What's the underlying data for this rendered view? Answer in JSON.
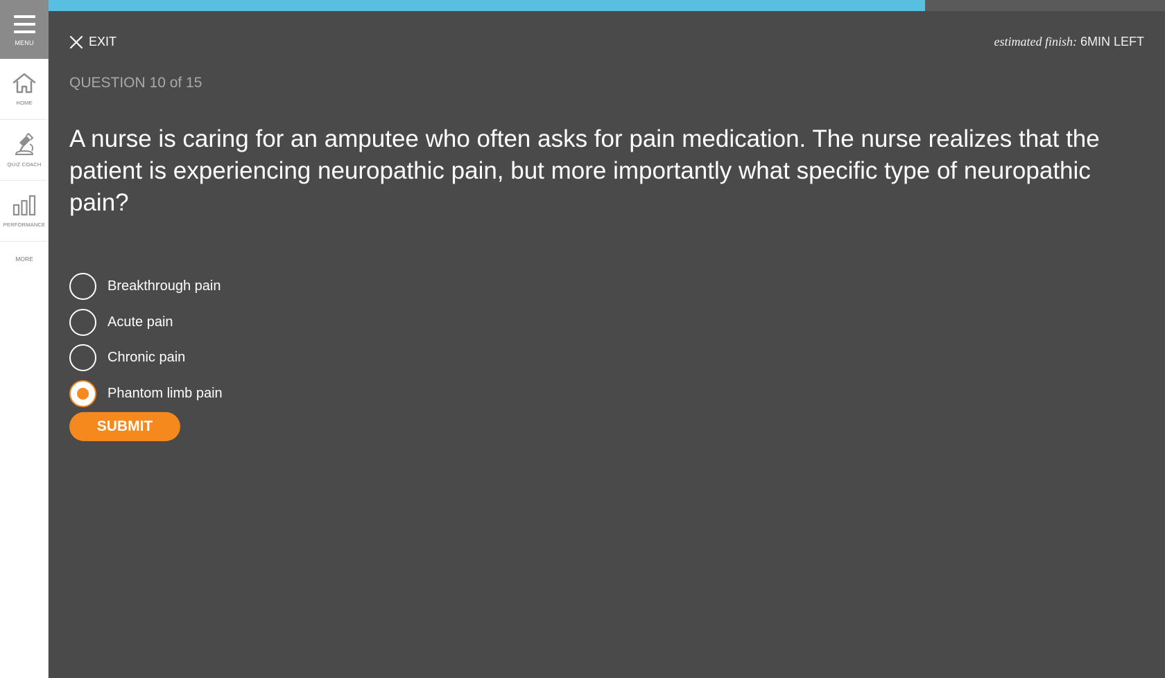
{
  "sidebar": {
    "menu_label": "MENU",
    "items": [
      {
        "label": "HOME",
        "icon": "home-icon"
      },
      {
        "label": "QUIZ COACH",
        "icon": "quiz-coach-icon"
      },
      {
        "label": "PERFORMANCE",
        "icon": "bar-chart-icon"
      }
    ],
    "more_label": "MORE"
  },
  "progress": {
    "fraction": 0.785,
    "color": "#59bfe1"
  },
  "header": {
    "exit_label": "EXIT",
    "estimate_prefix": "estimated finish:",
    "estimate_value": "6MIN LEFT"
  },
  "question": {
    "counter": "QUESTION 10 of 15",
    "text": "A nurse is caring for an amputee who often asks for pain medication. The nurse realizes that the patient is experiencing neuropathic pain, but more importantly what specific type of neuropathic pain?"
  },
  "options": [
    {
      "label": "Breakthrough pain",
      "selected": false
    },
    {
      "label": "Acute pain",
      "selected": false
    },
    {
      "label": "Chronic pain",
      "selected": false
    },
    {
      "label": "Phantom limb pain",
      "selected": true
    }
  ],
  "submit_label": "SUBMIT",
  "colors": {
    "accent": "#f5891d",
    "background": "#4a4a4a",
    "sidebar": "#ffffff",
    "progress": "#59bfe1"
  }
}
